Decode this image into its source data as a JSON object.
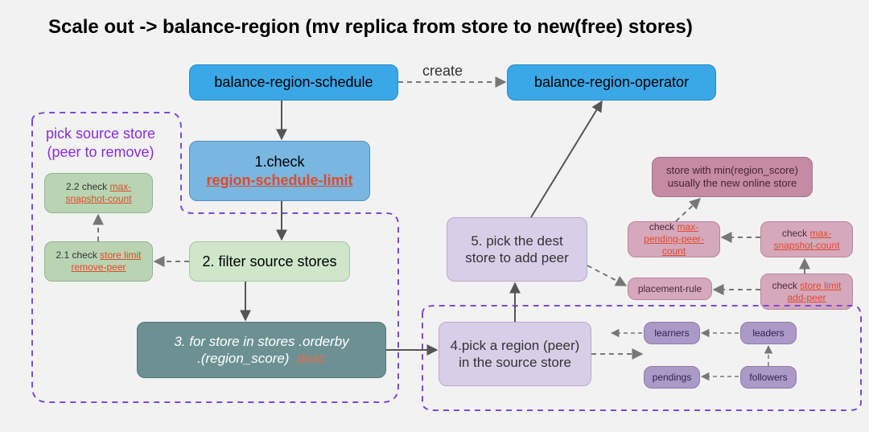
{
  "title": "Scale out -> balance-region (mv replica from store to new(free) stores)",
  "pick_source_label": "pick source store\n(peer to remove)",
  "create_label": "create",
  "nodes": {
    "schedule": "balance-region-schedule",
    "operator": "balance-region-operator",
    "step1_pre": "1.check",
    "step1_link": "region-schedule-limit",
    "step2": "2. filter source stores",
    "step2_1_pre": "2.1 check ",
    "step2_1_link": "store limit remove-peer",
    "step2_2_pre": "2.2 check ",
    "step2_2_link": "max-snapshot-count",
    "step3_a": "3. for store  in stores .orderby",
    "step3_b": ".(region_score) ",
    "step3_c": ".desc",
    "step4": "4.pick a region (peer) in the source store",
    "step5": "5. pick the dest store to add peer",
    "learners": "learners",
    "leaders": "leaders",
    "pendings": "pendings",
    "followers": "followers",
    "placement": "placement-rule",
    "chk_pend_pre": "check ",
    "chk_pend_link": "max-pending-peer-count",
    "chk_snap_pre": "check ",
    "chk_snap_link": "max-snapshot-count",
    "chk_add_pre": "check ",
    "chk_add_link": "store limit add-peer",
    "min_score": "store with min(region_score) usually the new online store"
  }
}
